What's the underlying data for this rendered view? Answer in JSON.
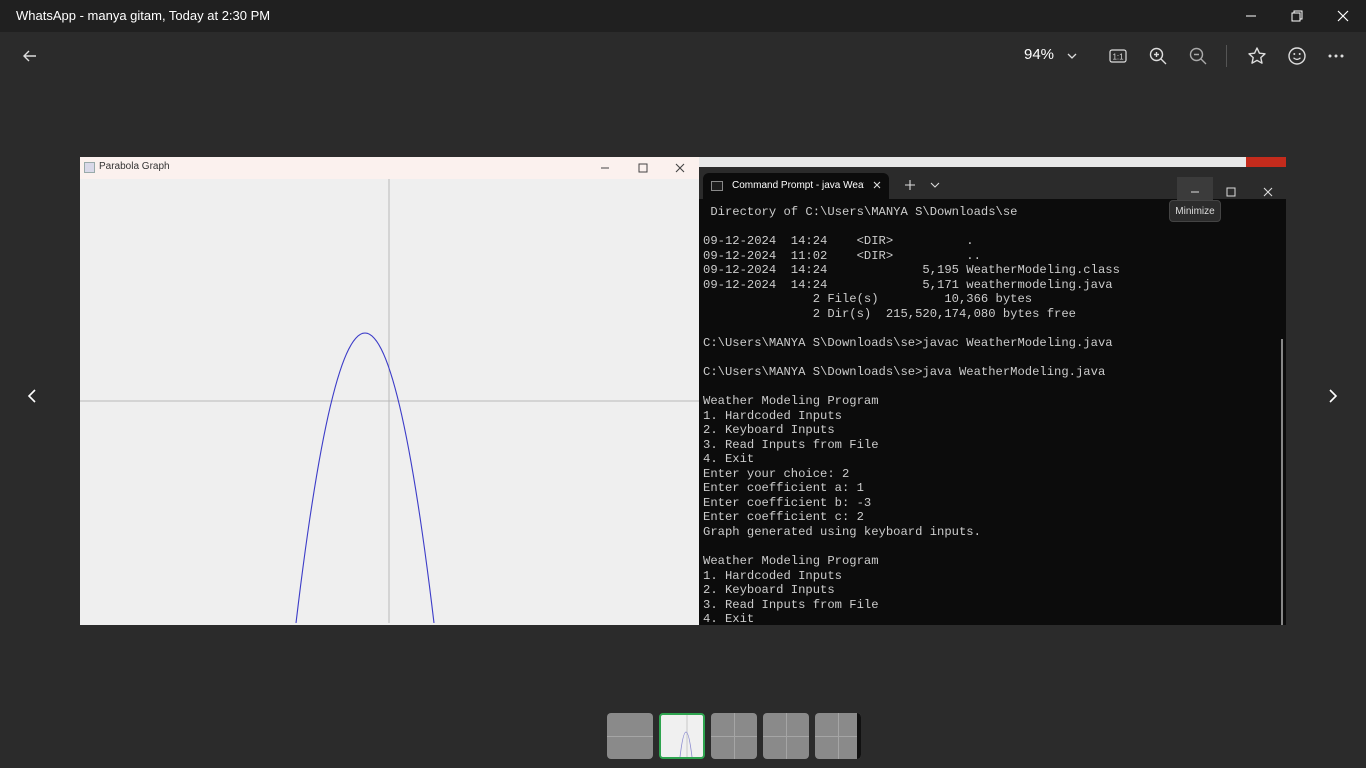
{
  "window": {
    "title": "WhatsApp - manya gitam, Today at 2:30 PM"
  },
  "toolbar": {
    "zoom_level": "94%"
  },
  "java_window": {
    "title": "Parabola Graph"
  },
  "terminal": {
    "tab_label": "Command Prompt - java  WeatherModeling.java",
    "tooltip": "Minimize",
    "lines": [
      " Directory of C:\\Users\\MANYA S\\Downloads\\se",
      "",
      "09-12-2024  14:24    <DIR>          .",
      "09-12-2024  11:02    <DIR>          ..",
      "09-12-2024  14:24             5,195 WeatherModeling.class",
      "09-12-2024  14:24             5,171 weathermodeling.java",
      "               2 File(s)         10,366 bytes",
      "               2 Dir(s)  215,520,174,080 bytes free",
      "",
      "C:\\Users\\MANYA S\\Downloads\\se>javac WeatherModeling.java",
      "",
      "C:\\Users\\MANYA S\\Downloads\\se>java WeatherModeling.java",
      "",
      "Weather Modeling Program",
      "1. Hardcoded Inputs",
      "2. Keyboard Inputs",
      "3. Read Inputs from File",
      "4. Exit",
      "Enter your choice: 2",
      "Enter coefficient a: 1",
      "Enter coefficient b: -3",
      "Enter coefficient c: 2",
      "Graph generated using keyboard inputs.",
      "",
      "Weather Modeling Program",
      "1. Hardcoded Inputs",
      "2. Keyboard Inputs",
      "3. Read Inputs from File",
      "4. Exit"
    ]
  },
  "colors": {
    "accent_green": "#2ea44f",
    "curve_blue": "#3c3cc8",
    "terminal_text": "#cccccc"
  },
  "icons": [
    "back-arrow-icon",
    "chevron-down-icon",
    "actual-size-icon",
    "zoom-in-icon",
    "zoom-out-icon",
    "star-icon",
    "emoji-icon",
    "more-icon",
    "chevron-left-icon",
    "chevron-right-icon",
    "minimize-icon",
    "maximize-icon",
    "close-icon"
  ]
}
